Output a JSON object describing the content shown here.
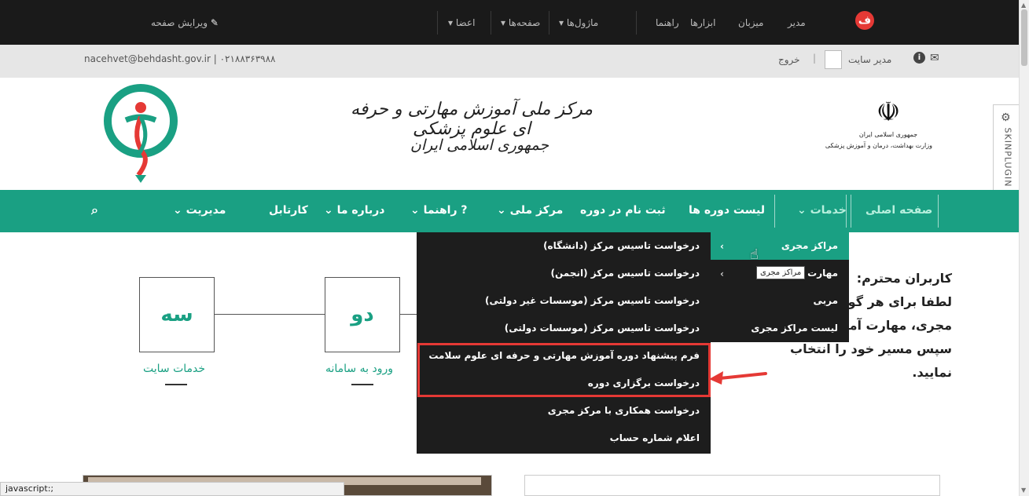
{
  "topbar": {
    "edit_page": "ویرایش صفحه",
    "members": "اعضا",
    "pages": "صفحه‌ها",
    "modules": "ماژول‌ها",
    "help": "راهنما",
    "tools": "ابزارها",
    "host": "میزبان",
    "admin": "مدیر"
  },
  "userbar": {
    "contact": "nacehvet@behdasht.gov.ir | ۰۲۱۸۸۳۶۳۹۸۸",
    "logout": "خروج",
    "site_admin": "مدیر سایت"
  },
  "header": {
    "title_line1": "مرکز ملی آموزش مهارتی و حرفه ای علوم پزشکی",
    "title_line2": "جمهوری اسلامی ایران",
    "ministry_line1": "جمهوری اسلامی ایران",
    "ministry_line2": "وزارت بهداشت، درمان و آموزش پزشکی",
    "skinplugin": "SKINPLUGIN"
  },
  "nav": {
    "home": "صفحه اصلی",
    "services": "خدمات",
    "course_list": "لیست دوره ها",
    "register": "ثبت نام در دوره",
    "national_center": "مرکز ملی",
    "guide": "راهنما",
    "about": "درباره ما",
    "cartable": "کارتابل",
    "management": "مدیریت"
  },
  "services_menu": {
    "items": [
      "مراکز مجری",
      "مهارت",
      "مربی",
      "لیست مراکز مجری"
    ],
    "tooltip": "مراکز مجری"
  },
  "submenu": {
    "items": [
      "درخواست تاسیس مرکز (دانشگاه)",
      "درخواست تاسیس مرکز (انجمن)",
      "درخواست تاسیس مرکز (موسسات غیر دولتی)",
      "درخواست تاسیس مرکز (موسسات دولتی)",
      "فرم پیشنهاد دوره آموزش مهارتی و حرفه ای علوم سلامت",
      "درخواست برگزاری دوره",
      "درخواست همکاری با مرکز مجری",
      "اعلام شماره حساب"
    ]
  },
  "content": {
    "notice_line1": "کاربران محترم:",
    "notice_line2": "لطفا برای هر گونه",
    "notice_line3": "مجری، مهارت آموز",
    "notice_line4": "سپس مسیر خود را انتخاب نمایید.",
    "step2": "دو",
    "step3": "سه",
    "step2_label": "ورود به سامانه",
    "step3_label": "خدمات سایت"
  },
  "status": "javascript:;",
  "colors": {
    "accent": "#1aa083",
    "highlight": "#e53935",
    "dark": "#1d1d1d"
  }
}
